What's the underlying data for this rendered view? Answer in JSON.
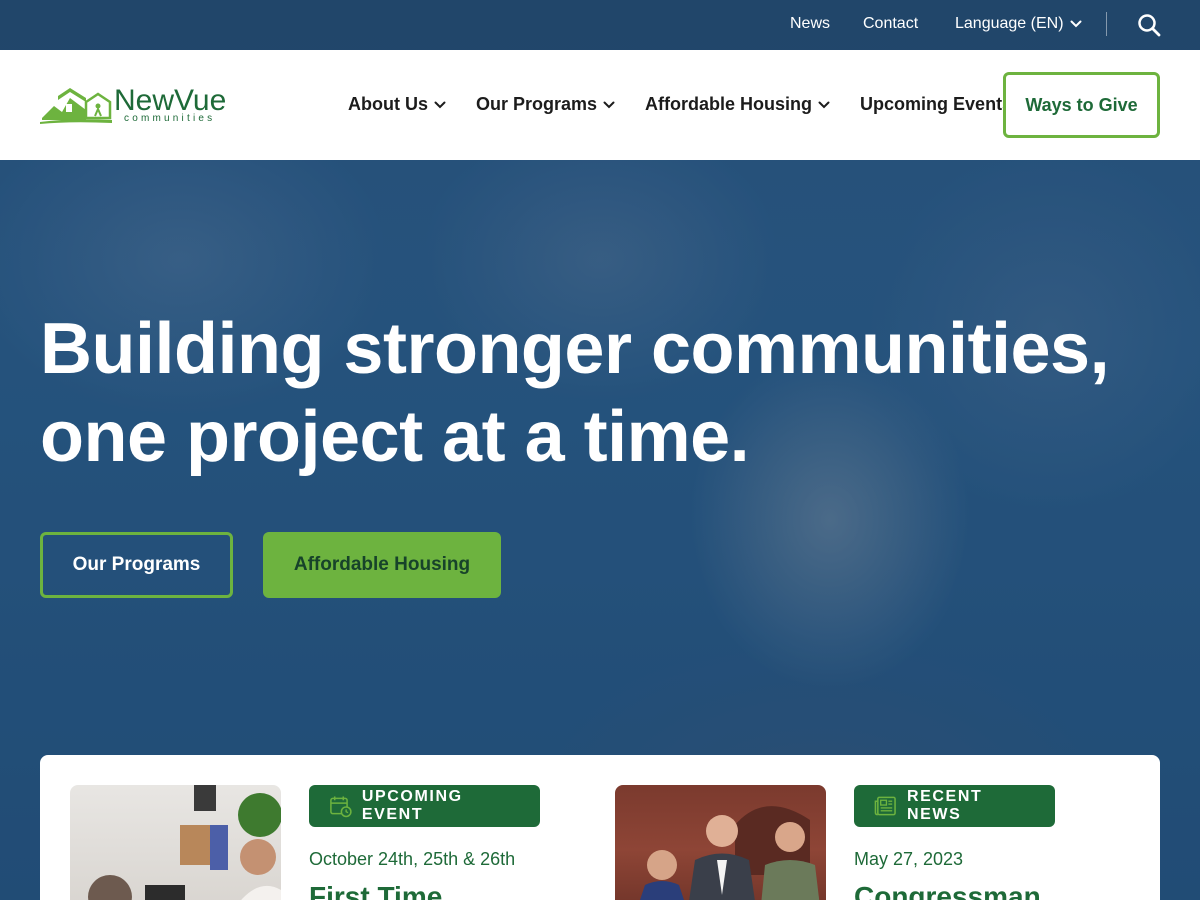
{
  "utility": {
    "news": "News",
    "contact": "Contact",
    "language": "Language (EN)"
  },
  "brand": {
    "name": "NewVue",
    "tagline": "communities",
    "green": "#6db33f",
    "dark_green": "#1e6a38"
  },
  "nav": {
    "items": [
      {
        "label": "About Us",
        "has_dropdown": true
      },
      {
        "label": "Our Programs",
        "has_dropdown": true
      },
      {
        "label": "Affordable Housing",
        "has_dropdown": true
      },
      {
        "label": "Upcoming Events",
        "has_dropdown": false
      }
    ],
    "cta": "Ways to Give"
  },
  "hero": {
    "title_line1": "Building stronger communities,",
    "title_line2": "one project at a time.",
    "primary_button": "Our Programs",
    "secondary_button": "Affordable Housing"
  },
  "highlights": {
    "event": {
      "tag": "UPCOMING EVENT",
      "icon": "calendar-clock-icon",
      "date": "October 24th, 25th & 26th",
      "title": "First Time"
    },
    "news": {
      "tag": "RECENT NEWS",
      "icon": "newspaper-icon",
      "date": "May 27, 2023",
      "title": "Congressman"
    }
  }
}
